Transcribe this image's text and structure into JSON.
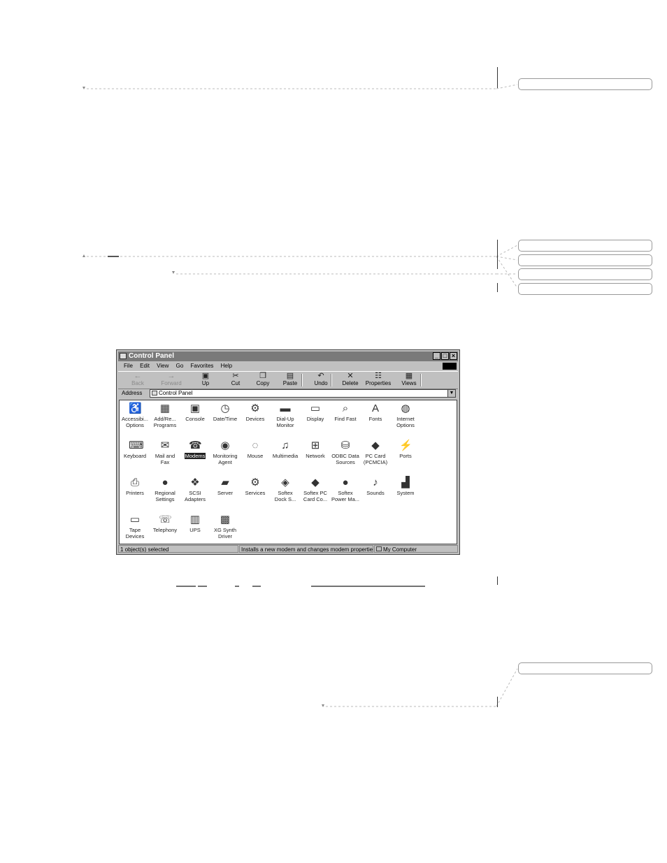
{
  "window": {
    "title": "Control Panel",
    "controls": {
      "minimize": "_",
      "maximize": "□",
      "close": "×"
    }
  },
  "menu": [
    "File",
    "Edit",
    "View",
    "Go",
    "Favorites",
    "Help"
  ],
  "toolbar": {
    "buttons": [
      {
        "label": "Back",
        "icon": "back-arrow-icon",
        "glyph": "←",
        "enabled": false
      },
      {
        "label": "Forward",
        "icon": "forward-arrow-icon",
        "glyph": "→",
        "enabled": false
      },
      {
        "label": "Up",
        "icon": "up-folder-icon",
        "glyph": "▣",
        "enabled": true
      },
      {
        "label": "Cut",
        "icon": "scissors-icon",
        "glyph": "✂",
        "enabled": true
      },
      {
        "label": "Copy",
        "icon": "copy-icon",
        "glyph": "❐",
        "enabled": true
      },
      {
        "label": "Paste",
        "icon": "paste-icon",
        "glyph": "▤",
        "enabled": true
      },
      {
        "label": "Undo",
        "icon": "undo-icon",
        "glyph": "↶",
        "enabled": true
      },
      {
        "label": "Delete",
        "icon": "delete-x-icon",
        "glyph": "✕",
        "enabled": true
      },
      {
        "label": "Properties",
        "icon": "properties-icon",
        "glyph": "☷",
        "enabled": true
      },
      {
        "label": "Views",
        "icon": "views-icon",
        "glyph": "▦",
        "enabled": true
      }
    ]
  },
  "address": {
    "label": "Address",
    "value": "Control Panel"
  },
  "items": [
    {
      "label": "Accessibi...\nOptions",
      "icon": "accessibility-icon",
      "glyph": "♿",
      "selected": false
    },
    {
      "label": "Add/Re...\nPrograms",
      "icon": "add-remove-programs-icon",
      "glyph": "▦",
      "selected": false
    },
    {
      "label": "Console",
      "icon": "console-icon",
      "glyph": "▣",
      "selected": false
    },
    {
      "label": "Date/Time",
      "icon": "calendar-clock-icon",
      "glyph": "◷",
      "selected": false
    },
    {
      "label": "Devices",
      "icon": "devices-icon",
      "glyph": "⚙",
      "selected": false
    },
    {
      "label": "Dial-Up\nMonitor",
      "icon": "dialup-monitor-icon",
      "glyph": "▬",
      "selected": false
    },
    {
      "label": "Display",
      "icon": "display-icon",
      "glyph": "▭",
      "selected": false
    },
    {
      "label": "Find Fast",
      "icon": "binoculars-icon",
      "glyph": "⌕",
      "selected": false
    },
    {
      "label": "Fonts",
      "icon": "fonts-folder-icon",
      "glyph": "A",
      "selected": false
    },
    {
      "label": "Internet\nOptions",
      "icon": "internet-options-icon",
      "glyph": "◍",
      "selected": false
    },
    {
      "label": "Keyboard",
      "icon": "keyboard-icon",
      "glyph": "⌨",
      "selected": false
    },
    {
      "label": "Mail and\nFax",
      "icon": "mail-fax-icon",
      "glyph": "✉",
      "selected": false
    },
    {
      "label": "Modems",
      "icon": "modem-icon",
      "glyph": "☎",
      "selected": true
    },
    {
      "label": "Monitoring\nAgent",
      "icon": "monitoring-agent-icon",
      "glyph": "◉",
      "selected": false
    },
    {
      "label": "Mouse",
      "icon": "mouse-icon",
      "glyph": "◌",
      "selected": false
    },
    {
      "label": "Multimedia",
      "icon": "multimedia-icon",
      "glyph": "♫",
      "selected": false
    },
    {
      "label": "Network",
      "icon": "network-icon",
      "glyph": "⊞",
      "selected": false
    },
    {
      "label": "ODBC Data\nSources",
      "icon": "odbc-icon",
      "glyph": "⛁",
      "selected": false
    },
    {
      "label": "PC Card\n(PCMCIA)",
      "icon": "pc-card-icon",
      "glyph": "◆",
      "selected": false
    },
    {
      "label": "Ports",
      "icon": "ports-icon",
      "glyph": "⚡",
      "selected": false
    },
    {
      "label": "Printers",
      "icon": "printers-folder-icon",
      "glyph": "⎙",
      "selected": false
    },
    {
      "label": "Regional\nSettings",
      "icon": "globe-icon",
      "glyph": "●",
      "selected": false
    },
    {
      "label": "SCSI\nAdapters",
      "icon": "scsi-adapters-icon",
      "glyph": "❖",
      "selected": false
    },
    {
      "label": "Server",
      "icon": "server-icon",
      "glyph": "▰",
      "selected": false
    },
    {
      "label": "Services",
      "icon": "services-gears-icon",
      "glyph": "⚙",
      "selected": false
    },
    {
      "label": "Softex\nDock S...",
      "icon": "dock-icon",
      "glyph": "◈",
      "selected": false
    },
    {
      "label": "Softex PC\nCard Co...",
      "icon": "pc-card-controller-icon",
      "glyph": "◆",
      "selected": false
    },
    {
      "label": "Softex\nPower Ma...",
      "icon": "power-management-icon",
      "glyph": "●",
      "selected": false
    },
    {
      "label": "Sounds",
      "icon": "speaker-icon",
      "glyph": "♪",
      "selected": false
    },
    {
      "label": "System",
      "icon": "computer-icon",
      "glyph": "▟",
      "selected": false
    },
    {
      "label": "Tape\nDevices",
      "icon": "tape-device-icon",
      "glyph": "▭",
      "selected": false
    },
    {
      "label": "Telephony",
      "icon": "telephone-icon",
      "glyph": "☏",
      "selected": false
    },
    {
      "label": "UPS",
      "icon": "ups-icon",
      "glyph": "▥",
      "selected": false
    },
    {
      "label": "XG Synth\nDriver",
      "icon": "xg-soft-icon",
      "glyph": "▩",
      "selected": false
    }
  ],
  "status": {
    "selection": "1 object(s) selected",
    "description": "Installs a new modem and changes modem properties.",
    "zone": "My Computer"
  }
}
